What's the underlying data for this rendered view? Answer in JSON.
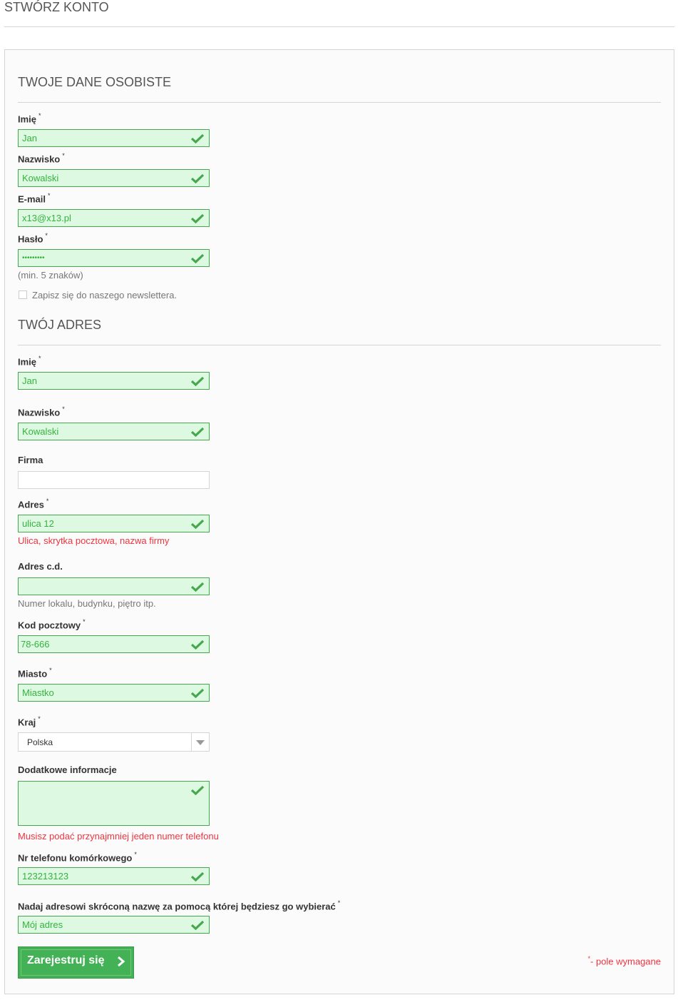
{
  "page": {
    "title": "STWÓRZ KONTO"
  },
  "personal": {
    "title": "TWOJE DANE OSOBISTE",
    "first_name": {
      "label": "Imię",
      "value": "Jan"
    },
    "last_name": {
      "label": "Nazwisko",
      "value": "Kowalski"
    },
    "email": {
      "label": "E-mail",
      "value": "x13@x13.pl"
    },
    "password": {
      "label": "Hasło",
      "value": "•••••••••",
      "hint": "(min. 5 znaków)"
    },
    "newsletter": {
      "label": "Zapisz się do naszego newslettera."
    }
  },
  "address": {
    "title": "TWÓJ ADRES",
    "first_name": {
      "label": "Imię",
      "value": "Jan"
    },
    "last_name": {
      "label": "Nazwisko",
      "value": "Kowalski"
    },
    "company": {
      "label": "Firma",
      "value": ""
    },
    "address1": {
      "label": "Adres",
      "value": "ulica 12",
      "hint": "Ulica, skrytka pocztowa, nazwa firmy"
    },
    "address2": {
      "label": "Adres c.d.",
      "value": "",
      "hint": "Numer lokalu, budynku, piętro itp."
    },
    "postcode": {
      "label": "Kod pocztowy",
      "value": "78-666"
    },
    "city": {
      "label": "Miasto",
      "value": "Miastko"
    },
    "country": {
      "label": "Kraj",
      "value": "Polska"
    },
    "other": {
      "label": "Dodatkowe informacje",
      "value": ""
    },
    "phone_notice": "Musisz podać przynajmniej jeden numer telefonu",
    "mobile": {
      "label": "Nr telefonu komórkowego",
      "value": "123213123"
    },
    "alias": {
      "label": "Nadaj adresowi skróconą nazwę za pomocą której będziesz go wybierać",
      "value": "Mój adres"
    }
  },
  "required_marker": "*",
  "submit_label": "Zarejestruj się",
  "required_note": "- pole wymagane",
  "colors": {
    "valid_border": "#46a74e",
    "valid_bg": "#ddf9e1",
    "valid_text": "#35b33f",
    "error_text": "#f13340",
    "button": "#43b155"
  }
}
